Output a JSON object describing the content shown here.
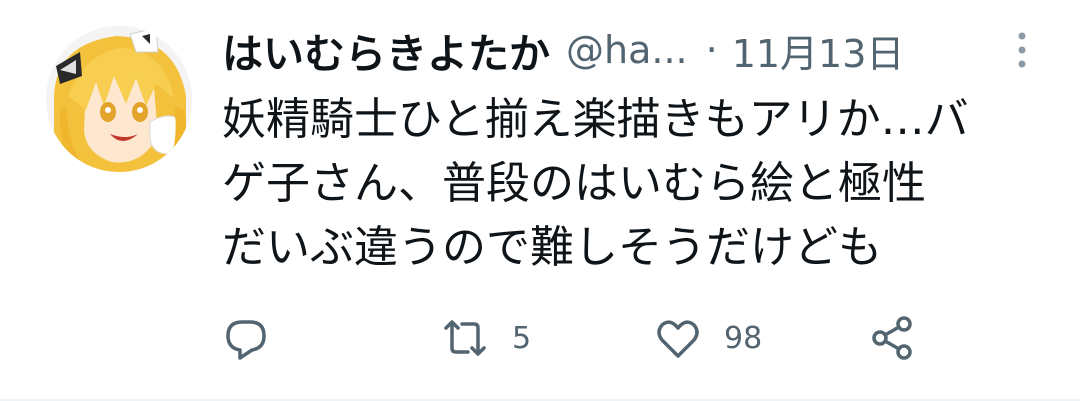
{
  "tweet": {
    "display_name": "はいむらきよたか",
    "handle": "@ha...",
    "separator": "·",
    "timestamp": "11月13日",
    "body_lines": [
      "妖精騎士ひと揃え楽描きもアリか…バ",
      "ゲ子さん、普段のはいむら絵と極性",
      "だいぶ違うので難しそうだけども"
    ],
    "actions": {
      "reply": {
        "icon": "reply-icon",
        "count": ""
      },
      "retweet": {
        "icon": "retweet-icon",
        "count": "5"
      },
      "like": {
        "icon": "heart-icon",
        "count": "98"
      },
      "share": {
        "icon": "share-icon",
        "count": ""
      }
    },
    "more_icon": "more-vertical-icon"
  },
  "colors": {
    "text_primary": "#0f1419",
    "text_secondary": "#536471",
    "icon": "#536471",
    "avatar_hair": "#f5c542"
  }
}
